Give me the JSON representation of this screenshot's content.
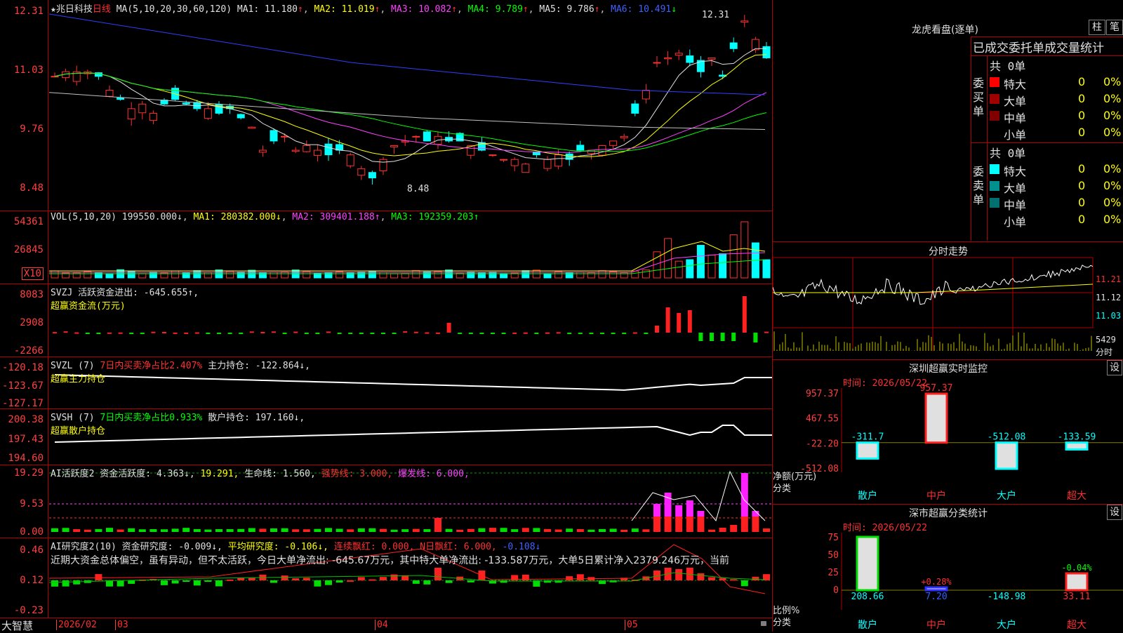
{
  "header": {
    "star": "★",
    "name": "兆日科技",
    "period": "日线",
    "ma_label": "MA(5,10,20,30,60,120)",
    "ma": [
      {
        "label": "MA1: 11.180",
        "arrow": "↑",
        "color": "#e0e0e0"
      },
      {
        "label": "MA2: 11.019",
        "arrow": "↑",
        "color": "#ffff00"
      },
      {
        "label": "MA3: 10.082",
        "arrow": "↑",
        "color": "#ff40ff"
      },
      {
        "label": "MA4: 9.789",
        "arrow": "↑",
        "color": "#00ff00"
      },
      {
        "label": "MA5: 9.786",
        "arrow": "↑",
        "color": "#e0e0e0"
      },
      {
        "label": "MA6: 10.491",
        "arrow": "↓",
        "color": "#4060ff"
      }
    ],
    "high_mark": "12.31",
    "low_mark": "8.48"
  },
  "price_axis": [
    "12.31",
    "11.03",
    "9.76",
    "8.48"
  ],
  "vol": {
    "label": "VOL(5,10,20)",
    "val": "199550.000↓",
    "ma1": "MA1: 280382.000↓",
    "ma2": "MA2: 309401.188↑",
    "ma3": "MA3: 192359.203↑",
    "axis": [
      "54361",
      "26845",
      "X10"
    ]
  },
  "svzj": {
    "label": "SVZJ  活跃资金进出: -645.655↑,",
    "sub": "超赢资金流(万元)",
    "axis": [
      "8083",
      "2908",
      "-2266"
    ]
  },
  "svzl": {
    "label": "SVZL (7)",
    "pct": "7日内买卖净占比2.407%",
    "hold": "主力持仓: -122.864↓,",
    "sub": "超赢主力持仓",
    "axis": [
      "-120.18",
      "-123.67",
      "-127.17"
    ]
  },
  "svsh": {
    "label": "SVSH (7)",
    "pct": "7日内买卖净占比0.933%",
    "hold": "散户持仓: 197.160↓,",
    "sub": "超赢散户持仓",
    "axis": [
      "200.38",
      "197.43",
      "194.60"
    ]
  },
  "ai1": {
    "label": "AI活跃度2 资金活跃度: 4.363↓,",
    "v2": "19.291,",
    "life": "生命线: 1.560,",
    "strong": "强势线: 3.000,",
    "burst": "爆发线: 6.000,",
    "axis": [
      "19.29",
      "9.53",
      "0.00"
    ]
  },
  "ai2": {
    "label": "AI研究度2(10) 资金研究度: -0.009↓,",
    "avg": "平均研究度: -0.106↓,",
    "lx": "连续飘红: 0.000,",
    "nx": "N日飘红: 6.000,",
    "last": "-0.108↓",
    "text": "近期大资金总体偏空，虽有异动，但不太活跃，今日大单净流出: -645.67万元，其中特大单净流出: -133.587万元，大单5日累计净入2379.246万元，当前",
    "axis": [
      "0.46",
      "0.12",
      "-0.23"
    ]
  },
  "bottom": {
    "brand": "大智慧",
    "dates": [
      "2026/02",
      "03",
      "04",
      "05"
    ]
  },
  "lhb": {
    "title": "龙虎看盘(逐单)",
    "btn1": "柱",
    "btn2": "笔",
    "subtitle": "已成交委托单成交量统计",
    "buy": {
      "total": "共 0单",
      "side": "委买单",
      "rows": [
        [
          "特大",
          "0",
          "0%"
        ],
        [
          "大单",
          "0",
          "0%"
        ],
        [
          "中单",
          "0",
          "0%"
        ],
        [
          "小单",
          "0",
          "0%"
        ]
      ]
    },
    "sell": {
      "total": "共 0单",
      "side": "委卖单",
      "rows": [
        [
          "特大",
          "0",
          "0%"
        ],
        [
          "大单",
          "0",
          "0%"
        ],
        [
          "中单",
          "0",
          "0%"
        ],
        [
          "小单",
          "0",
          "0%"
        ]
      ]
    }
  },
  "intraday": {
    "title": "分时走势",
    "axis": [
      "11.21",
      "11.12",
      "11.03",
      "5429",
      "分时"
    ]
  },
  "monitor": {
    "title": "深圳超赢实时监控",
    "btn": "设",
    "time": "时间: 2026/05/22",
    "axis": [
      "957.37",
      "467.55",
      "-22.20",
      "-512.08"
    ],
    "ylabel1": "净额(万元)",
    "ylabel2": "分类",
    "cats": [
      "散户",
      "中户",
      "大户",
      "超大"
    ],
    "values": [
      -311.7,
      957.37,
      -512.08,
      -133.59
    ],
    "labels": [
      "-311.7",
      "957.37",
      "-512.08",
      "-133.59"
    ]
  },
  "classify": {
    "title": "深市超赢分类统计",
    "btn": "设",
    "time": "时间: 2026/05/22",
    "axis": [
      "75",
      "50",
      "25",
      "0"
    ],
    "ylabel1": "比例%",
    "ylabel2": "分类",
    "cats": [
      "散户",
      "中户",
      "大户",
      "超大"
    ],
    "bar_labels": [
      "+0.28%",
      "-0.04%"
    ],
    "values": [
      "208.66",
      "7.20",
      "-148.98",
      "33.11"
    ]
  },
  "chart_data": [
    {
      "type": "candlestick",
      "title": "兆日科技 日线",
      "ylim": [
        8.48,
        12.31
      ],
      "y_ticks": [
        12.31,
        11.03,
        9.76,
        8.48
      ],
      "x_ticks": [
        "2026/02",
        "03",
        "04",
        "05"
      ],
      "high": 12.31,
      "low": 8.48
    },
    {
      "type": "bar",
      "title": "VOL(5,10,20)",
      "y_ticks": [
        54361,
        26845
      ]
    },
    {
      "type": "bar",
      "title": "SVZJ 超赢资金流(万元)",
      "y_ticks": [
        8083,
        2908,
        -2266
      ]
    },
    {
      "type": "bar",
      "title": "深圳超赢实时监控",
      "categories": [
        "散户",
        "中户",
        "大户",
        "超大"
      ],
      "values": [
        -311.7,
        957.37,
        -512.08,
        -133.59
      ],
      "ylim": [
        -512.08,
        957.37
      ]
    },
    {
      "type": "bar",
      "title": "深市超赢分类统计",
      "categories": [
        "散户",
        "中户",
        "大户",
        "超大"
      ],
      "values": [
        208.66,
        7.2,
        -148.98,
        33.11
      ]
    }
  ]
}
